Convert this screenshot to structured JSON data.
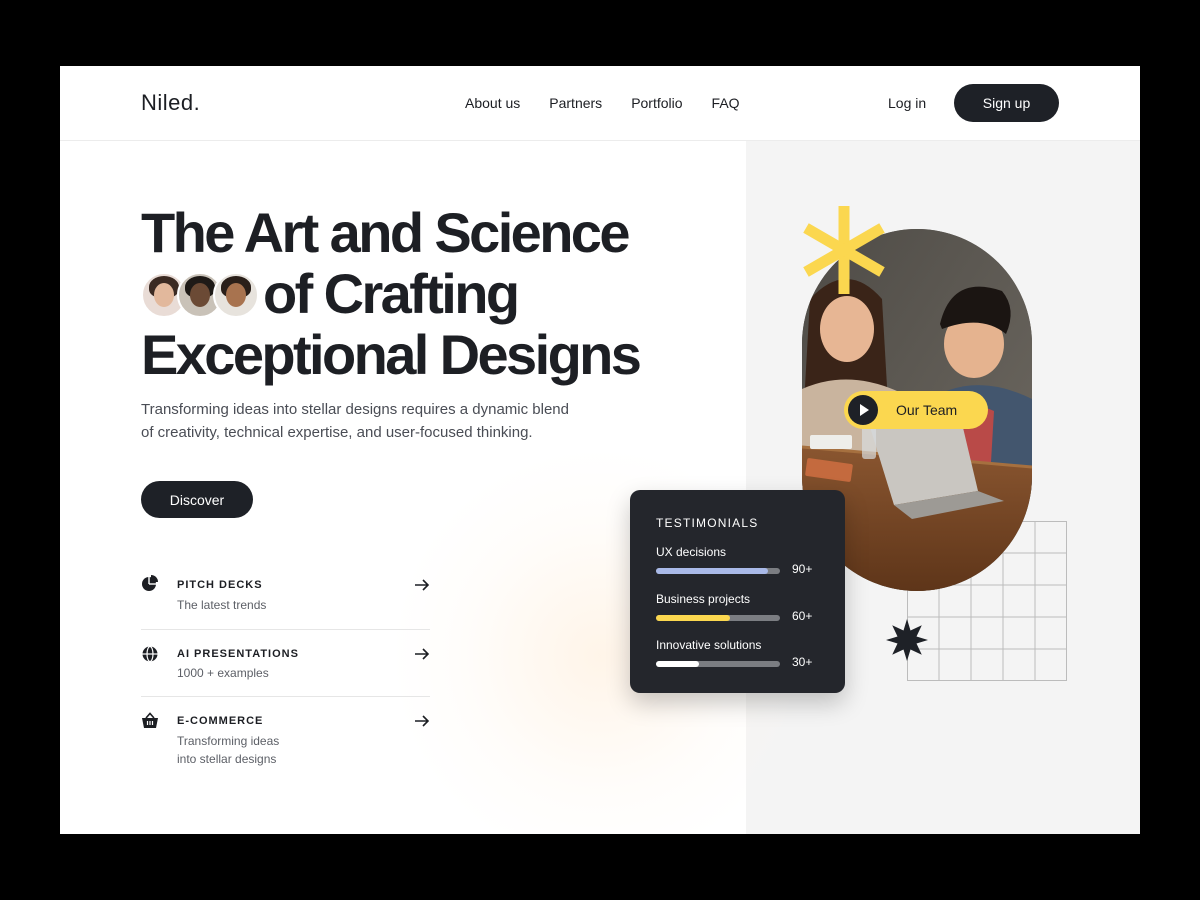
{
  "brand": {
    "logo": "Niled."
  },
  "nav": {
    "links": [
      "About us",
      "Partners",
      "Portfolio",
      "FAQ"
    ],
    "login": "Log in",
    "signup": "Sign up"
  },
  "hero": {
    "headline_line1": "The Art and Science",
    "headline_line2": "of Crafting",
    "headline_line3": "Exceptional Designs",
    "subtitle": "Transforming ideas into stellar designs requires a dynamic blend of creativity, technical expertise, and user-focused thinking.",
    "cta": "Discover"
  },
  "features": [
    {
      "title": "PITCH DECKS",
      "desc": "The latest trends",
      "icon": "pie-chart-icon"
    },
    {
      "title": "AI PRESENTATIONS",
      "desc": "1000 + examples",
      "icon": "globe-icon"
    },
    {
      "title": "E-COMMERCE",
      "desc": "Transforming ideas into stellar designs",
      "icon": "basket-icon"
    }
  ],
  "team": {
    "button": "Our Team"
  },
  "testimonials": {
    "title": "TESTIMONIALS",
    "metrics": [
      {
        "label": "UX decisions",
        "value": "90+",
        "fill": 0.9,
        "color": "#a9b9e8"
      },
      {
        "label": "Business projects",
        "value": "60+",
        "fill": 0.6,
        "color": "#fbd74f"
      },
      {
        "label": "Innovative solutions",
        "value": "30+",
        "fill": 0.35,
        "color": "#ffffff"
      }
    ]
  },
  "colors": {
    "dark": "#1e2127",
    "accent_yellow": "#fbd74f",
    "panel": "#f4f4f4"
  }
}
